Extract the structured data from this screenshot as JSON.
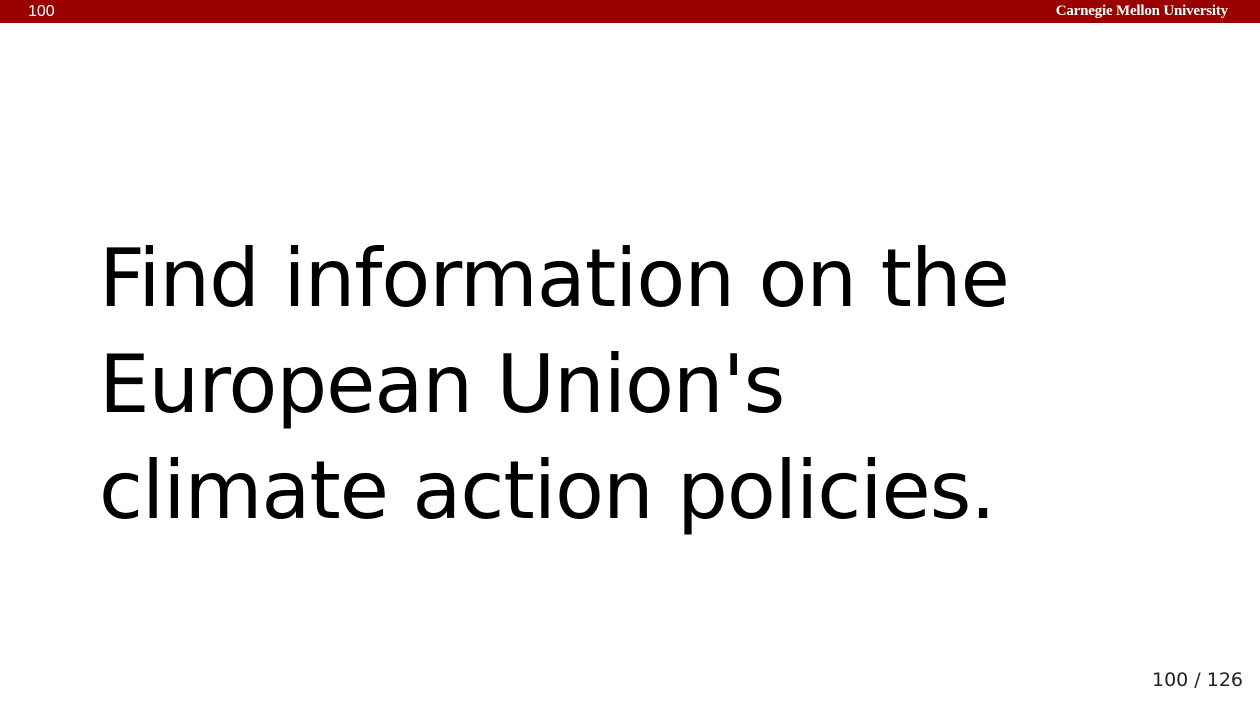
{
  "header": {
    "slide_number": "100",
    "logo_text": "Carnegie Mellon University",
    "bar_color": "#990000"
  },
  "slide": {
    "lines": [
      "Find information on the",
      "European Union's",
      "climate action policies."
    ]
  },
  "footer": {
    "page_counter": "100 / 126"
  }
}
